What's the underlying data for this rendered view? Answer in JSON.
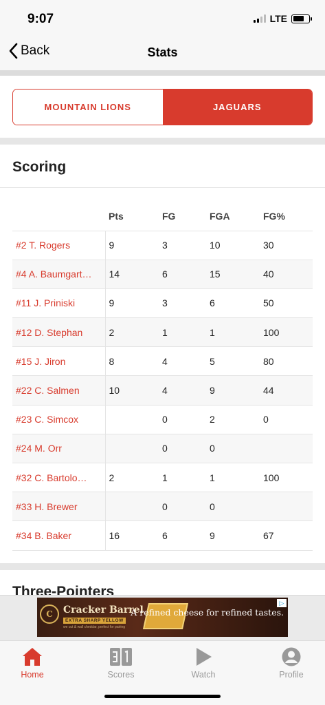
{
  "status_bar": {
    "time": "9:07",
    "network": "LTE"
  },
  "nav": {
    "back_label": "Back",
    "title": "Stats"
  },
  "teams": {
    "left": "MOUNTAIN LIONS",
    "right": "JAGUARS",
    "selected": "right"
  },
  "scoring": {
    "title": "Scoring",
    "columns": [
      "",
      "Pts",
      "FG",
      "FGA",
      "FG%"
    ],
    "rows": [
      {
        "player": "#2 T. Rogers",
        "pts": "9",
        "fg": "3",
        "fga": "10",
        "fgp": "30"
      },
      {
        "player": "#4 A. Baumgart…",
        "pts": "14",
        "fg": "6",
        "fga": "15",
        "fgp": "40"
      },
      {
        "player": "#11 J. Priniski",
        "pts": "9",
        "fg": "3",
        "fga": "6",
        "fgp": "50"
      },
      {
        "player": "#12 D. Stephan",
        "pts": "2",
        "fg": "1",
        "fga": "1",
        "fgp": "100"
      },
      {
        "player": "#15 J. Jiron",
        "pts": "8",
        "fg": "4",
        "fga": "5",
        "fgp": "80"
      },
      {
        "player": "#22 C. Salmen",
        "pts": "10",
        "fg": "4",
        "fga": "9",
        "fgp": "44"
      },
      {
        "player": "#23 C. Simcox",
        "pts": "",
        "fg": "0",
        "fga": "2",
        "fgp": "0"
      },
      {
        "player": "#24 M. Orr",
        "pts": "",
        "fg": "0",
        "fga": "0",
        "fgp": ""
      },
      {
        "player": "#32 C. Bartolo…",
        "pts": "2",
        "fg": "1",
        "fga": "1",
        "fgp": "100"
      },
      {
        "player": "#33 H. Brewer",
        "pts": "",
        "fg": "0",
        "fga": "0",
        "fgp": ""
      },
      {
        "player": "#34 B. Baker",
        "pts": "16",
        "fg": "6",
        "fga": "9",
        "fgp": "67"
      }
    ]
  },
  "next_section": {
    "title": "Three-Pointers"
  },
  "ad": {
    "brand": "Cracker Barrel",
    "sub": "EXTRA SHARP YELLOW",
    "fine": "we cut & wall cheddar, perfect for pairing",
    "headline": "A refined cheese for refined tastes.",
    "logo_letter": "C"
  },
  "tabbar": {
    "items": [
      {
        "label": "Home",
        "icon": "home-icon",
        "active": true
      },
      {
        "label": "Scores",
        "icon": "scores-icon",
        "active": false
      },
      {
        "label": "Watch",
        "icon": "play-icon",
        "active": false
      },
      {
        "label": "Profile",
        "icon": "profile-icon",
        "active": false
      }
    ]
  },
  "colors": {
    "accent": "#d83b2d",
    "inactive": "#999999"
  }
}
